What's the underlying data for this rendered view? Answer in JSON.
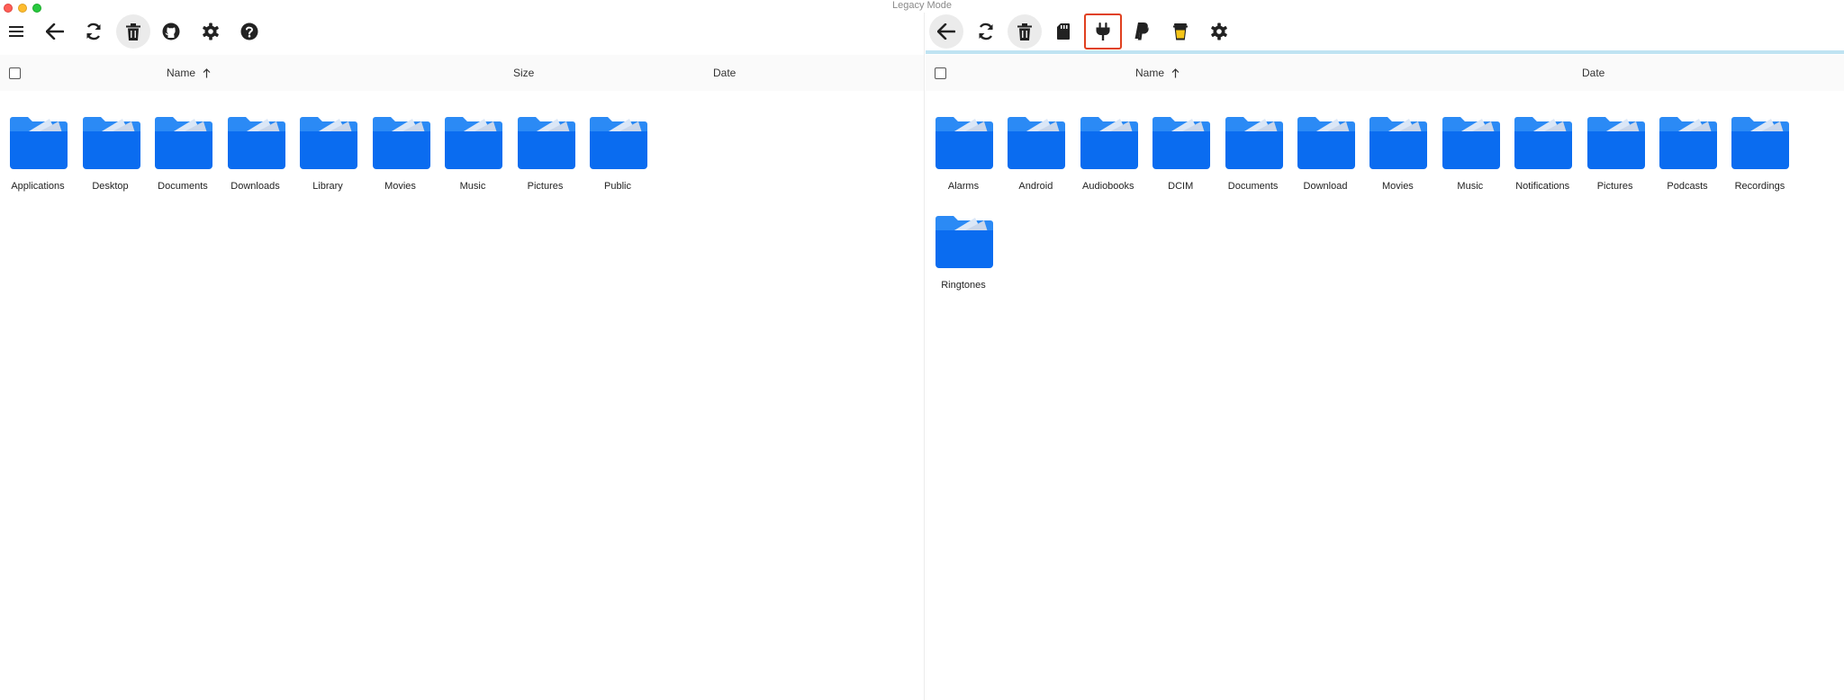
{
  "window": {
    "title": "Legacy Mode"
  },
  "left_pane": {
    "toolbar": {
      "buttons": [
        {
          "icon": "menu-icon"
        },
        {
          "icon": "back-arrow-icon"
        },
        {
          "icon": "refresh-icon"
        },
        {
          "icon": "trash-icon"
        },
        {
          "icon": "github-icon"
        },
        {
          "icon": "gear-icon"
        },
        {
          "icon": "help-icon"
        }
      ]
    },
    "columns": {
      "name": "Name",
      "size": "Size",
      "date": "Date"
    },
    "folders": [
      "Applications",
      "Desktop",
      "Documents",
      "Downloads",
      "Library",
      "Movies",
      "Music",
      "Pictures",
      "Public"
    ]
  },
  "right_pane": {
    "toolbar": {
      "buttons": [
        {
          "icon": "back-arrow-icon"
        },
        {
          "icon": "refresh-icon"
        },
        {
          "icon": "trash-icon"
        },
        {
          "icon": "sd-card-icon"
        },
        {
          "icon": "plug-icon"
        },
        {
          "icon": "paypal-icon"
        },
        {
          "icon": "coffee-cup-icon"
        },
        {
          "icon": "gear-icon"
        }
      ]
    },
    "columns": {
      "name": "Name",
      "date": "Date"
    },
    "folders": [
      "Alarms",
      "Android",
      "Audiobooks",
      "DCIM",
      "Documents",
      "Download",
      "Movies",
      "Music",
      "Notifications",
      "Pictures",
      "Podcasts",
      "Recordings",
      "Ringtones"
    ]
  },
  "colors": {
    "folder_blue": "#0a6cf0",
    "folder_tab": "#2b8af5",
    "highlight_border": "#e0401f",
    "progress_line": "#bfe3f2",
    "coffee_yellow": "#f5c518"
  }
}
